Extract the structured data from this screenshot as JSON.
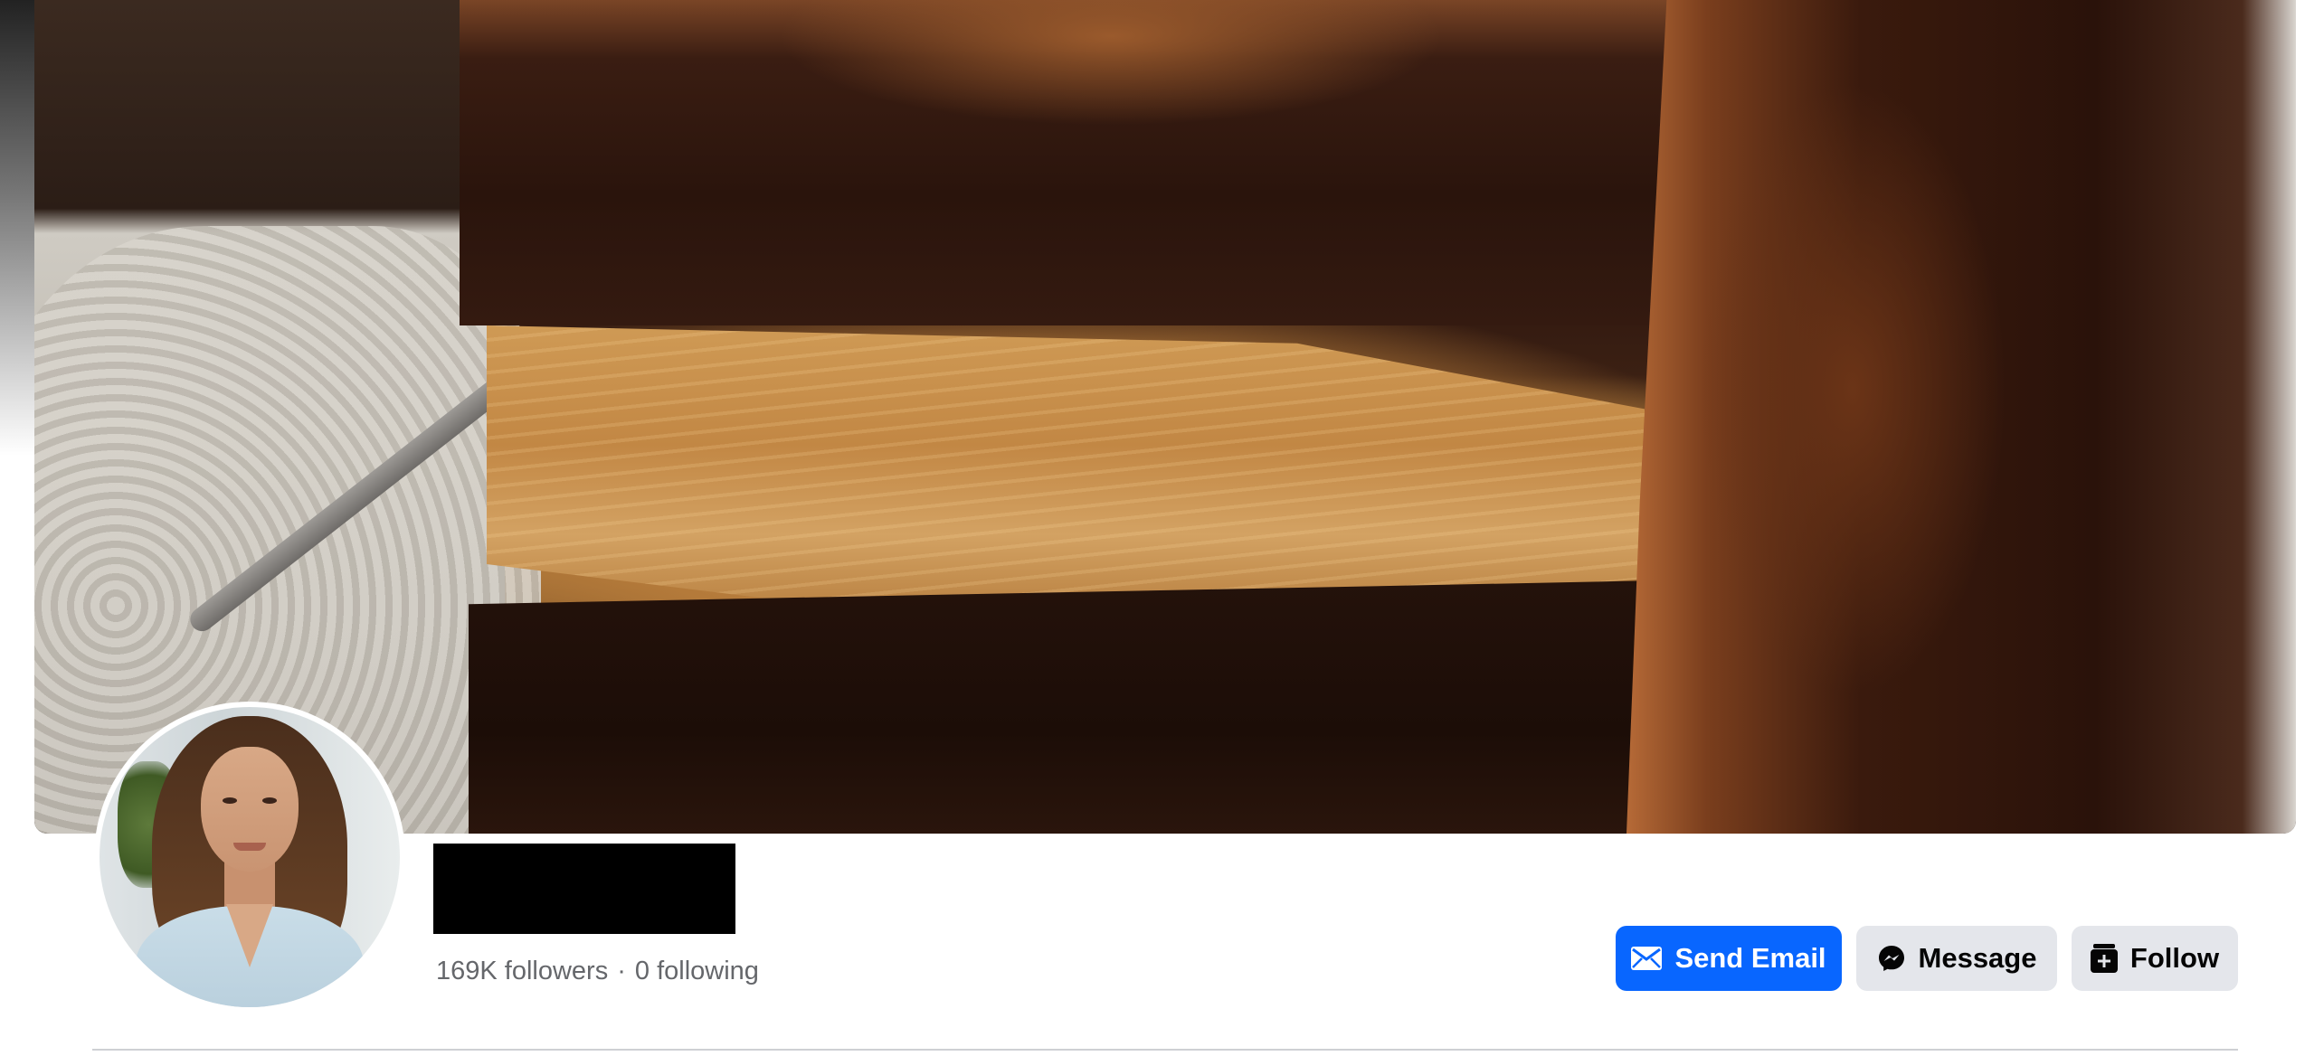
{
  "cover": {
    "image": "chocolate-peanut-butter-cake-slice"
  },
  "profile": {
    "avatar": "profile-photo-woman",
    "name_redacted": true,
    "followers_text": "169K followers",
    "separator": "·",
    "following_text": "0 following"
  },
  "actions": {
    "send_email_label": "Send Email",
    "send_email_icon": "envelope-icon",
    "message_label": "Message",
    "message_icon": "messenger-icon",
    "follow_label": "Follow",
    "follow_icon": "follow-plus-icon"
  },
  "colors": {
    "primary_button": "#0866ff",
    "secondary_button": "#e4e6eb",
    "muted_text": "#65676b"
  }
}
